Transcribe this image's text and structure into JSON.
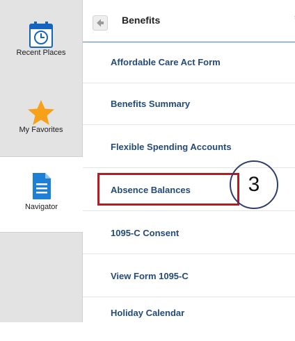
{
  "sidebar": {
    "items": [
      {
        "label": "Recent Places",
        "icon": "calendar-clock-icon"
      },
      {
        "label": "My Favorites",
        "icon": "star-icon"
      },
      {
        "label": "Navigator",
        "icon": "document-icon"
      }
    ]
  },
  "header": {
    "title": "Benefits",
    "back_icon": "back-arrow-icon",
    "pin_icon": "pin-icon"
  },
  "menu": {
    "items": [
      {
        "label": "Affordable Care Act Form"
      },
      {
        "label": "Benefits Summary"
      },
      {
        "label": "Flexible Spending Accounts"
      },
      {
        "label": "Absence Balances"
      },
      {
        "label": "1095-C Consent"
      },
      {
        "label": "View Form 1095-C"
      },
      {
        "label": "Holiday Calendar"
      }
    ]
  },
  "annotation": {
    "step_number": "3"
  },
  "colors": {
    "accent": "#1565c0",
    "menu_text": "#234a7a",
    "highlight": "#b01e23",
    "star": "#f7a11a"
  }
}
